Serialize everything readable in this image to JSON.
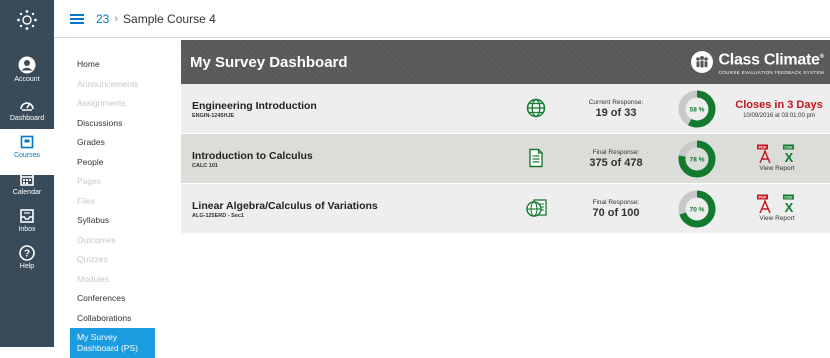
{
  "global_nav": {
    "items": [
      {
        "label": "Account"
      },
      {
        "label": "Dashboard"
      },
      {
        "label": "Courses"
      },
      {
        "label": "Calendar"
      },
      {
        "label": "Inbox"
      },
      {
        "label": "Help"
      }
    ]
  },
  "header": {
    "course_number": "23",
    "separator": "›",
    "course_name": "Sample Course 4"
  },
  "course_nav": {
    "items": [
      {
        "label": "Home",
        "enabled": true
      },
      {
        "label": "Announcements",
        "enabled": false
      },
      {
        "label": "Assignments",
        "enabled": false
      },
      {
        "label": "Discussions",
        "enabled": true
      },
      {
        "label": "Grades",
        "enabled": true
      },
      {
        "label": "People",
        "enabled": true
      },
      {
        "label": "Pages",
        "enabled": false
      },
      {
        "label": "Files",
        "enabled": false
      },
      {
        "label": "Syllabus",
        "enabled": true
      },
      {
        "label": "Outcomes",
        "enabled": false
      },
      {
        "label": "Quizzes",
        "enabled": false
      },
      {
        "label": "Modules",
        "enabled": false
      },
      {
        "label": "Conferences",
        "enabled": true
      },
      {
        "label": "Collaborations",
        "enabled": true
      }
    ],
    "selected_line1": "My Survey",
    "selected_line2": "Dashboard (PS)"
  },
  "dashboard": {
    "title": "My Survey Dashboard",
    "brand_name": "Class Climate",
    "brand_reg": "®",
    "brand_tagline": "COURSE EVALUATION FEEDBACK SYSTEM",
    "colors": {
      "accent_green": "#137a2e",
      "closes_red": "#c4161c",
      "donut_gray": "#c8c8c8"
    },
    "surveys": [
      {
        "title": "Engineering Introduction",
        "code": "ENGIN-1245HJE",
        "status_icon": "globe-icon",
        "response_label": "Current Response:",
        "response_value": "19 of 33",
        "percent": 58,
        "percent_label": "58 %",
        "closes_text": "Closes in 3 Days",
        "closes_date": "10/09/2016 at 03:01:00 pm"
      },
      {
        "title": "Introduction to Calculus",
        "code": "CALC 101",
        "status_icon": "paper-form-icon",
        "response_label": "Final Response:",
        "response_value": "375 of 478",
        "percent": 78,
        "percent_label": "78 %",
        "pdf_label": "PDF",
        "csv_label": "CSV",
        "report_label": "View Report"
      },
      {
        "title": "Linear Algebra/Calculus of Variations",
        "code": "ALG-125ERD - Sec1",
        "status_icon": "globe-and-paper-icon",
        "response_label": "Final Response:",
        "response_value": "70 of 100",
        "percent": 70,
        "percent_label": "70 %",
        "pdf_label": "PDF",
        "csv_label": "CSV",
        "report_label": "View Report"
      }
    ]
  }
}
